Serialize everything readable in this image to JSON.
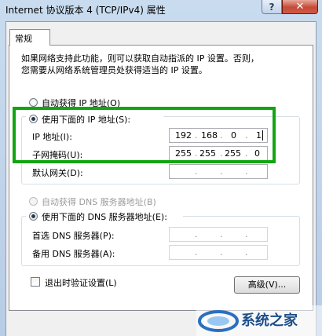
{
  "window": {
    "title": "Internet 协议版本 4 (TCP/IPv4) 属性",
    "help_label": "?",
    "close_label": "✕"
  },
  "tabs": [
    {
      "label": "常规",
      "active": true
    }
  ],
  "description": {
    "line1": "如果网络支持此功能，则可以获取自动指派的 IP 设置。否则，",
    "line2": "您需要从网络系统管理员处获得适当的 IP 设置。"
  },
  "ip_section": {
    "auto_label": "自动获得 IP 地址(O)",
    "manual_label": "使用下面的 IP 地址(S):",
    "selected": "manual",
    "ip_label": "IP 地址(I):",
    "ip_value": [
      "192",
      "168",
      "0",
      "1"
    ],
    "mask_label": "子网掩码(U):",
    "mask_value": [
      "255",
      "255",
      "255",
      "0"
    ],
    "gateway_label": "默认网关(D):",
    "gateway_value": [
      "",
      "",
      "",
      ""
    ]
  },
  "dns_section": {
    "auto_label": "自动获得 DNS 服务器地址(B)",
    "manual_label": "使用下面的 DNS 服务器地址(E):",
    "selected": "manual",
    "preferred_label": "首选 DNS 服务器(P):",
    "alternate_label": "备用 DNS 服务器(A):"
  },
  "validate_on_exit": {
    "label": "退出时验证设置(L)",
    "checked": false
  },
  "advanced_button": "高级(V)...",
  "watermark": {
    "text": "系统之家"
  },
  "colors": {
    "highlight_box": "#12a512",
    "close_button": "#c44a37"
  }
}
